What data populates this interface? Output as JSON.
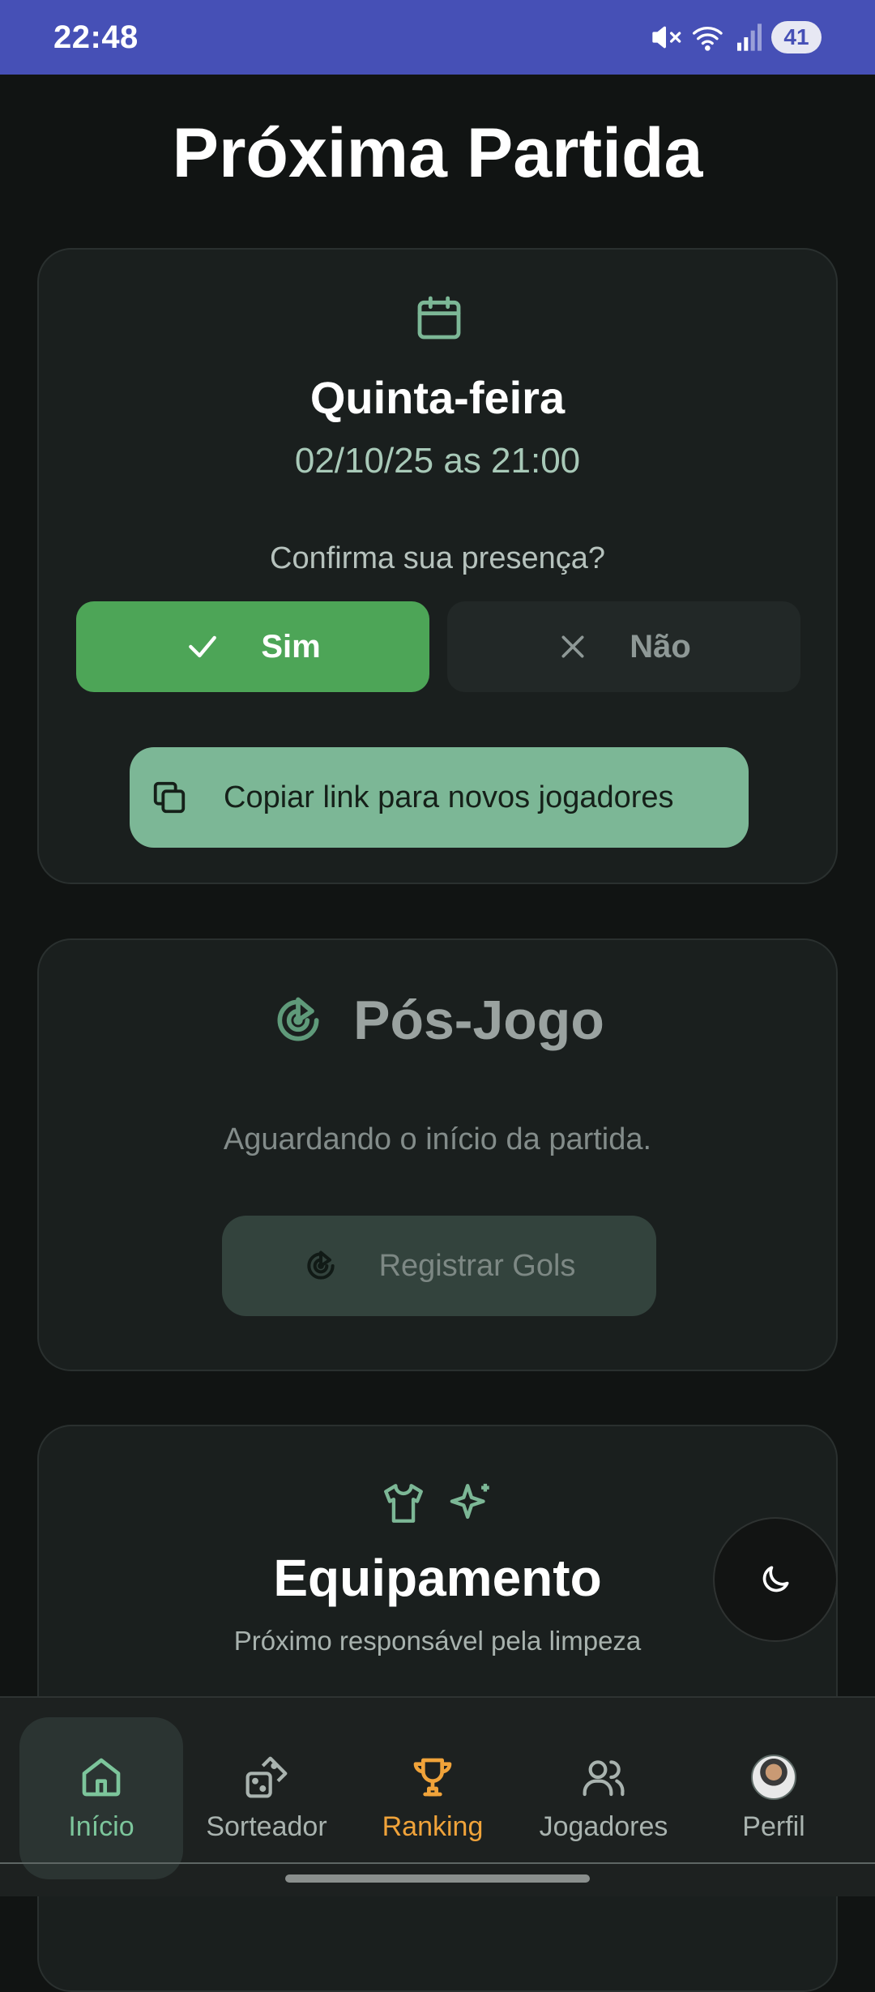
{
  "status_bar": {
    "time": "22:48",
    "battery": "41"
  },
  "page_title": "Próxima Partida",
  "match": {
    "day": "Quinta-feira",
    "datetime": "02/10/25 as 21:00",
    "question": "Confirma sua presença?",
    "yes_label": "Sim",
    "no_label": "Não",
    "copy_link_label": "Copiar link para novos jogadores"
  },
  "postgame": {
    "title": "Pós-Jogo",
    "waiting_text": "Aguardando o início da partida.",
    "register_label": "Registrar Gols"
  },
  "equipment": {
    "title": "Equipamento",
    "subtitle": "Próximo responsável pela limpeza"
  },
  "bottom_nav": {
    "items": [
      {
        "label": "Início",
        "icon": "home-icon",
        "active": true
      },
      {
        "label": "Sorteador",
        "icon": "dice-icon"
      },
      {
        "label": "Ranking",
        "icon": "trophy-icon"
      },
      {
        "label": "Jogadores",
        "icon": "users-icon"
      },
      {
        "label": "Perfil",
        "icon": "avatar"
      }
    ]
  },
  "colors": {
    "status_bar": "#4650b6",
    "accent_green": "#4da557",
    "mint": "#7cb796",
    "ranking": "#f0a33a",
    "background": "#111413"
  }
}
